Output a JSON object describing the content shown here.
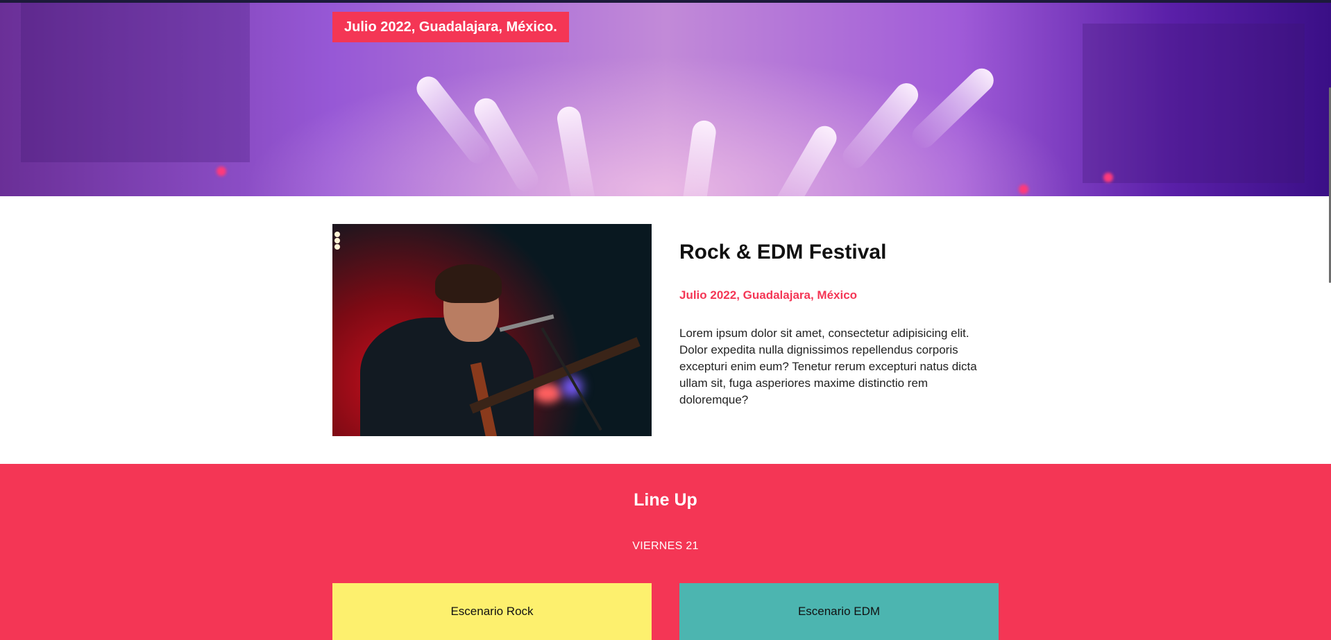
{
  "hero": {
    "badge_text": "Julio 2022, Guadalajara, México."
  },
  "event": {
    "title": "Rock & EDM Festival",
    "subtitle": "Julio 2022, Guadalajara, México",
    "description": "Lorem ipsum dolor sit amet, consectetur adipisicing elit. Dolor expedita nulla dignissimos repellendus corporis excepturi enim eum? Tenetur rerum excepturi natus dicta ullam sit, fuga asperiores maxime distinctio rem doloremque?"
  },
  "lineup": {
    "title": "Line Up",
    "day": "VIERNES 21",
    "stages": [
      {
        "label": "Escenario Rock",
        "color": "#fdf06e"
      },
      {
        "label": "Escenario EDM",
        "color": "#4cb5b0"
      }
    ]
  },
  "colors": {
    "accent": "#f43655",
    "hero_purple": "#9758d6",
    "text_dark": "#111111"
  }
}
